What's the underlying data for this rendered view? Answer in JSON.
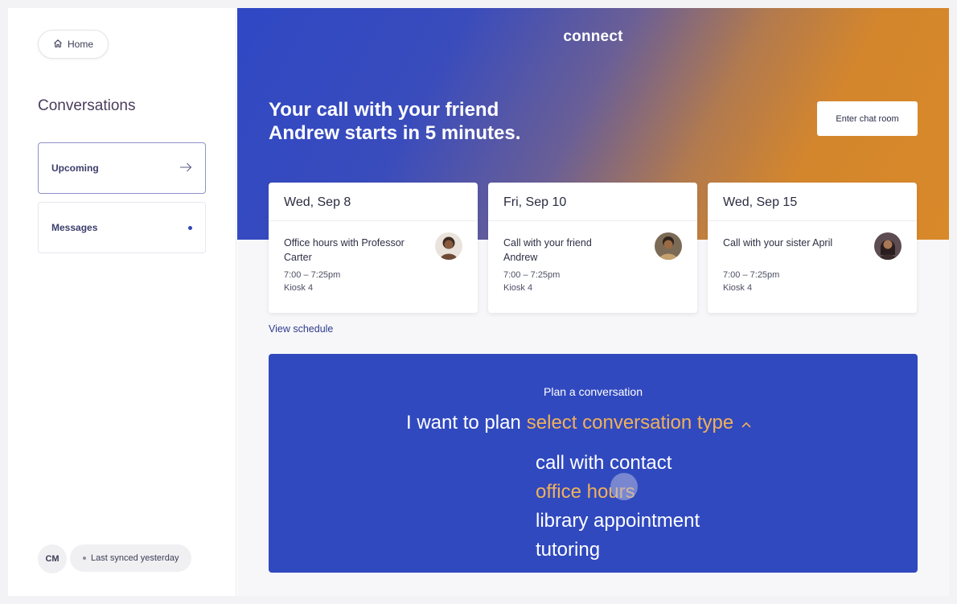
{
  "sidebar": {
    "home_label": "Home",
    "section_title": "Conversations",
    "items": [
      {
        "label": "Upcoming",
        "indicator": "arrow-right-icon",
        "active": true
      },
      {
        "label": "Messages",
        "indicator": "unread-dot",
        "active": false
      }
    ],
    "user_initials": "CM",
    "sync_status": "Last synced yesterday"
  },
  "header": {
    "logo": "connect",
    "message": "Your call with your friend Andrew starts in 5 minutes.",
    "enter_button": "Enter chat room"
  },
  "cards": [
    {
      "date": "Wed, Sep 8",
      "title": "Office hours with Professor Carter",
      "time": "7:00 – 7:25pm",
      "location": "Kiosk 4"
    },
    {
      "date": "Fri, Sep 10",
      "title": "Call with your friend Andrew",
      "time": "7:00 – 7:25pm",
      "location": "Kiosk 4"
    },
    {
      "date": "Wed, Sep 15",
      "title": "Call with your sister April",
      "time": "7:00 – 7:25pm",
      "location": "Kiosk 4"
    }
  ],
  "view_schedule": "View schedule",
  "plan": {
    "heading": "Plan a conversation",
    "prefix": "I want to plan",
    "select_label": "select conversation type",
    "options": [
      "call with contact",
      "office hours",
      "library appointment",
      "tutoring"
    ],
    "highlighted_option": "office hours"
  },
  "colors": {
    "brand_blue": "#3049bf",
    "accent_orange": "#f0b15a",
    "hero_orange": "#d8892a"
  }
}
